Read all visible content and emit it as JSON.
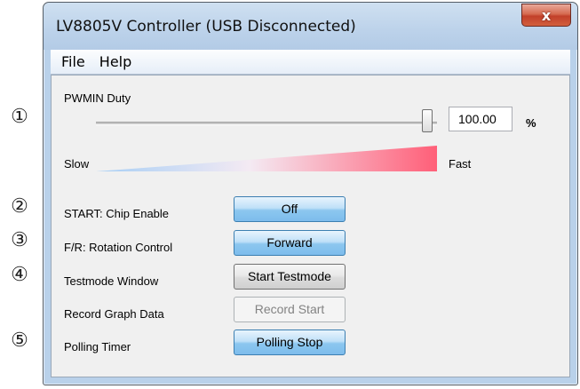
{
  "window": {
    "title": "LV8805V Controller (USB Disconnected)",
    "close_label": "x"
  },
  "menu": {
    "items": [
      "File",
      "Help"
    ]
  },
  "callouts": [
    "①",
    "②",
    "③",
    "④",
    "⑤"
  ],
  "pwm": {
    "label": "PWMIN Duty",
    "value": "100.00",
    "unit": "%",
    "slider_fraction": 1.0,
    "slow_label": "Slow",
    "fast_label": "Fast",
    "gradient_colors": [
      "#a6cef5",
      "#ff5f78"
    ]
  },
  "controls": [
    {
      "label": "START: Chip Enable",
      "button": "Off",
      "style": "active"
    },
    {
      "label": "F/R: Rotation Control",
      "button": "Forward",
      "style": "active"
    },
    {
      "label": "Testmode Window",
      "button": "Start Testmode",
      "style": "normal"
    },
    {
      "label": "Record Graph Data",
      "button": "Record Start",
      "style": "disabled"
    },
    {
      "label": "Polling Timer",
      "button": "Polling Stop",
      "style": "active"
    }
  ]
}
